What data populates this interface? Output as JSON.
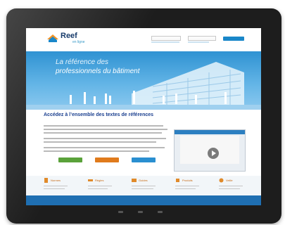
{
  "site": {
    "logo_text": "Reef",
    "logo_sub": "en ligne",
    "login_label": "",
    "password_label": "",
    "login_button": ""
  },
  "hero": {
    "line1": "La référence des",
    "line2": "professionnels du bâtiment"
  },
  "main": {
    "title": "Accédez à l’ensemble des textes de références",
    "subtitle": "",
    "cta_buttons": [
      "",
      "",
      ""
    ],
    "video_caption": ""
  },
  "features": [
    {
      "label": "Normes",
      "icon": "document-icon"
    },
    {
      "label": "Règles",
      "icon": "ruler-icon"
    },
    {
      "label": "Guides",
      "icon": "book-icon"
    },
    {
      "label": "Produits",
      "icon": "box-icon"
    },
    {
      "label": "Veille",
      "icon": "bell-icon"
    }
  ],
  "footer": {
    "left_link": "",
    "right_link": ""
  },
  "colors": {
    "brand_blue": "#1a87c9",
    "title_blue": "#1a3f8f",
    "feature_orange": "#c86a14",
    "cta_green": "#5aa23a",
    "cta_orange": "#e07b1c"
  }
}
